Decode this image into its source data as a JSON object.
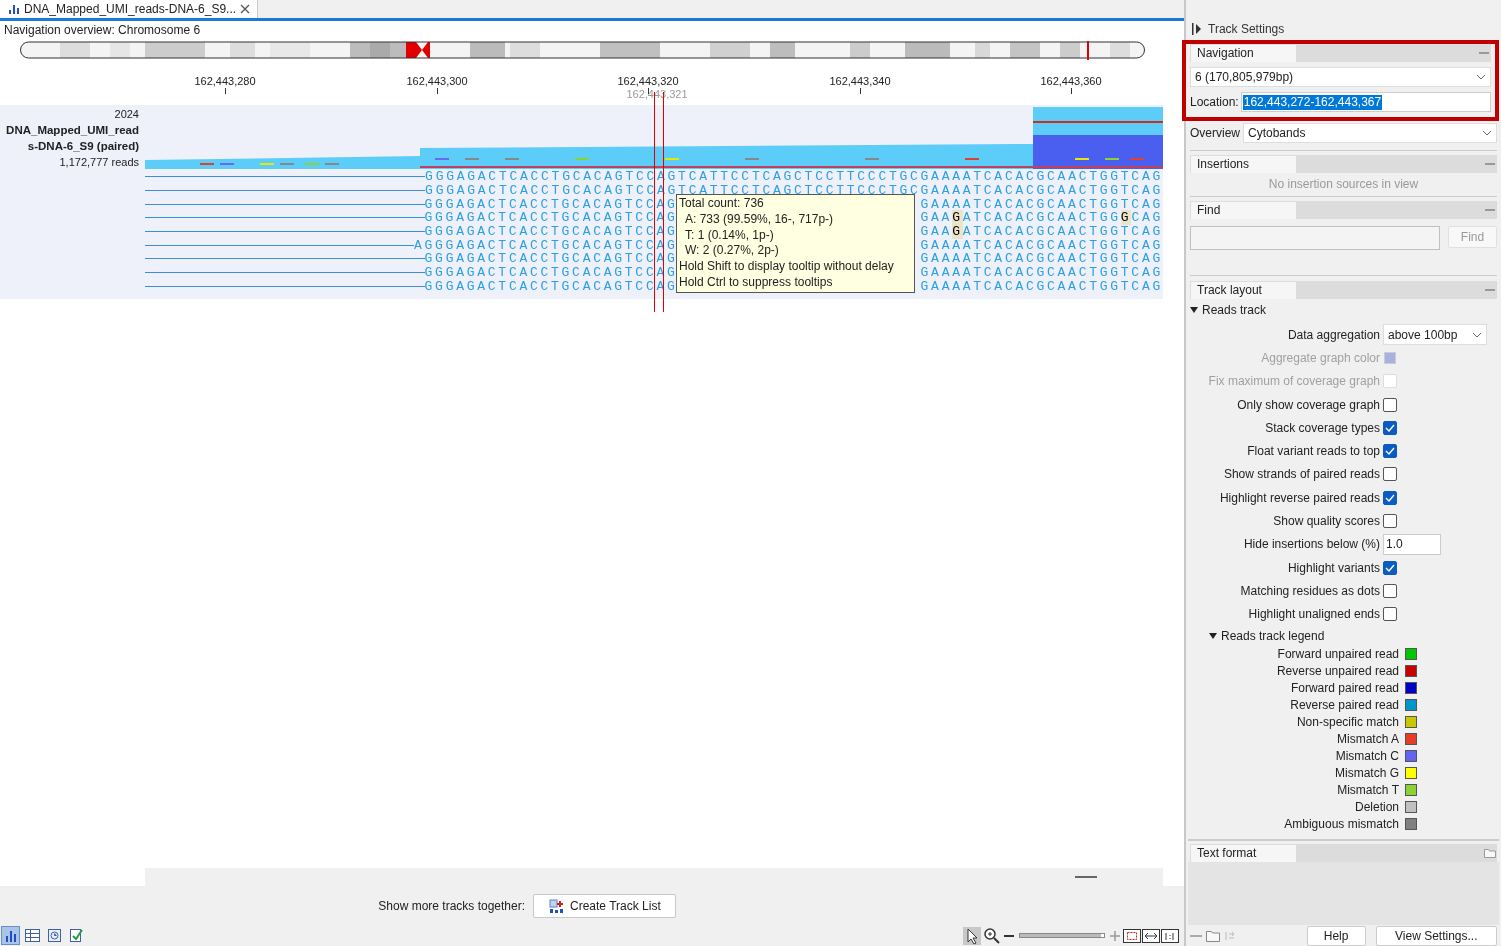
{
  "tab": {
    "title": "DNA_Mapped_UMI_reads-DNA-6_S9...",
    "selected": true
  },
  "overview": {
    "title": "Navigation overview: Chromosome 6"
  },
  "ruler": {
    "ticks": [
      "162,443,280",
      "162,443,300",
      "162,443,320",
      "162,443,340",
      "162,443,360"
    ],
    "cursor_label": "162,443,321"
  },
  "track": {
    "max_label": "2024",
    "name": "DNA_Mapped_UMI_reads-DNA-6_S9 (paired)",
    "reads_count": "1,172,777 reads"
  },
  "reads": [
    {
      "left": "GGGAGACTCACCTGCACAGTCCAGTCATTCCTCAGCTCCTTCCCTGCGAAAATCACACGCAACTGGTCAG"
    },
    {
      "left": "GGGAGACTCACCTGCACAGTCCAGTCATTCCTCAGCTCCTTCCCTGCGAAAATCACACGCAACTGGTCAG"
    },
    {
      "left": "GGGAGACTCACCTGCACAGTCCAG",
      "right": "GAAAATCACACGCAACTGGTCAG"
    },
    {
      "left": "GGGAGACTCACCTGCACAGTCCAG",
      "right": "GAA**G**ATCACACGCAACTGG**G**CAG"
    },
    {
      "left": "GGGAGACTCACCTGCACAGTCCAG",
      "right": "GAA**G**ATCACACGCAACTGGTCAG"
    },
    {
      "left": "AGGGAGACTCACCTGCACAGTCCAG",
      "right": "GAAAATCACACGCAACTGGTCAG"
    },
    {
      "left": "GGGAGACTCACCTGCACAGTCCAG",
      "right": "GAAAATCACACGCAACTGGTCAG"
    },
    {
      "left": "GGGAGACTCACCTGCACAGTCCAG",
      "right": "GAAAATCACACGCAACTGGTCAG"
    },
    {
      "left": "GGGAGACTCACCTGCACAGTCCAG",
      "right": "GAAAATCACACGCAACTGGTCAG"
    }
  ],
  "tooltip": {
    "lines": [
      "Total count: 736",
      "A: 733 (99.59%, 16-, 717p-)",
      "T: 1 (0.14%, 1p-)",
      "W: 2 (0.27%, 2p-)",
      "Hold Shift to display tooltip without delay",
      "Hold Ctrl to suppress tooltips"
    ]
  },
  "footer": {
    "label": "Show more tracks together:",
    "button": "Create Track List"
  },
  "views": [
    {
      "selected": true
    },
    {
      "selected": false
    },
    {
      "selected": false
    },
    {
      "selected": false
    }
  ],
  "zoom": {
    "level": 0.96
  },
  "panel": {
    "title": "Track Settings",
    "navigation": {
      "header": "Navigation",
      "chromosome": "6 (170,805,979bp)",
      "location_label": "Location:",
      "location": "162,443,272-162,443,367",
      "overview_label": "Overview",
      "overview_value": "Cytobands"
    },
    "insertions": {
      "header": "Insertions",
      "message": "No insertion sources in view"
    },
    "find": {
      "header": "Find",
      "button": "Find"
    },
    "track_layout": {
      "header": "Track layout",
      "group": "Reads track",
      "expanded": true,
      "settings": [
        {
          "kind": "select",
          "label": "Data aggregation",
          "value": "above 100bp",
          "disabled": false
        },
        {
          "kind": "color",
          "label": "Aggregate graph color",
          "color": "#a9b1e3",
          "disabled": true
        },
        {
          "kind": "checkbox",
          "label": "Fix maximum of coverage graph",
          "checked": false,
          "disabled": true
        },
        {
          "kind": "checkbox",
          "label": "Only show coverage graph",
          "checked": false,
          "disabled": false
        },
        {
          "kind": "checkbox",
          "label": "Stack coverage types",
          "checked": true,
          "disabled": false
        },
        {
          "kind": "checkbox",
          "label": "Float variant reads to top",
          "checked": true,
          "disabled": false
        },
        {
          "kind": "checkbox",
          "label": "Show strands of paired reads",
          "checked": false,
          "disabled": false
        },
        {
          "kind": "checkbox",
          "label": "Highlight reverse paired reads",
          "checked": true,
          "disabled": false
        },
        {
          "kind": "checkbox",
          "label": "Show quality scores",
          "checked": false,
          "disabled": false
        },
        {
          "kind": "text",
          "label": "Hide insertions below (%)",
          "value": "1.0",
          "disabled": false
        },
        {
          "kind": "checkbox",
          "label": "Highlight variants",
          "checked": true,
          "disabled": false
        },
        {
          "kind": "checkbox",
          "label": "Matching residues as dots",
          "checked": false,
          "disabled": false
        },
        {
          "kind": "checkbox",
          "label": "Highlight unaligned ends",
          "checked": false,
          "disabled": false
        }
      ],
      "legend": {
        "title": "Reads track legend",
        "expanded": true,
        "items": [
          {
            "label": "Forward unpaired read",
            "color": "#00c800"
          },
          {
            "label": "Reverse unpaired read",
            "color": "#c80000"
          },
          {
            "label": "Forward paired read",
            "color": "#0000c8"
          },
          {
            "label": "Reverse paired read",
            "color": "#0096c8"
          },
          {
            "label": "Non-specific match",
            "color": "#c8c800"
          },
          {
            "label": "Mismatch A",
            "color": "#e63c28"
          },
          {
            "label": "Mismatch C",
            "color": "#6464f0"
          },
          {
            "label": "Mismatch G",
            "color": "#ffff00"
          },
          {
            "label": "Mismatch T",
            "color": "#8cd232"
          },
          {
            "label": "Deletion",
            "color": "#c0c0c0"
          },
          {
            "label": "Ambiguous mismatch",
            "color": "#808080"
          }
        ]
      }
    },
    "text_format": {
      "header": "Text format"
    },
    "buttons": [
      "Help",
      "View Settings..."
    ]
  }
}
